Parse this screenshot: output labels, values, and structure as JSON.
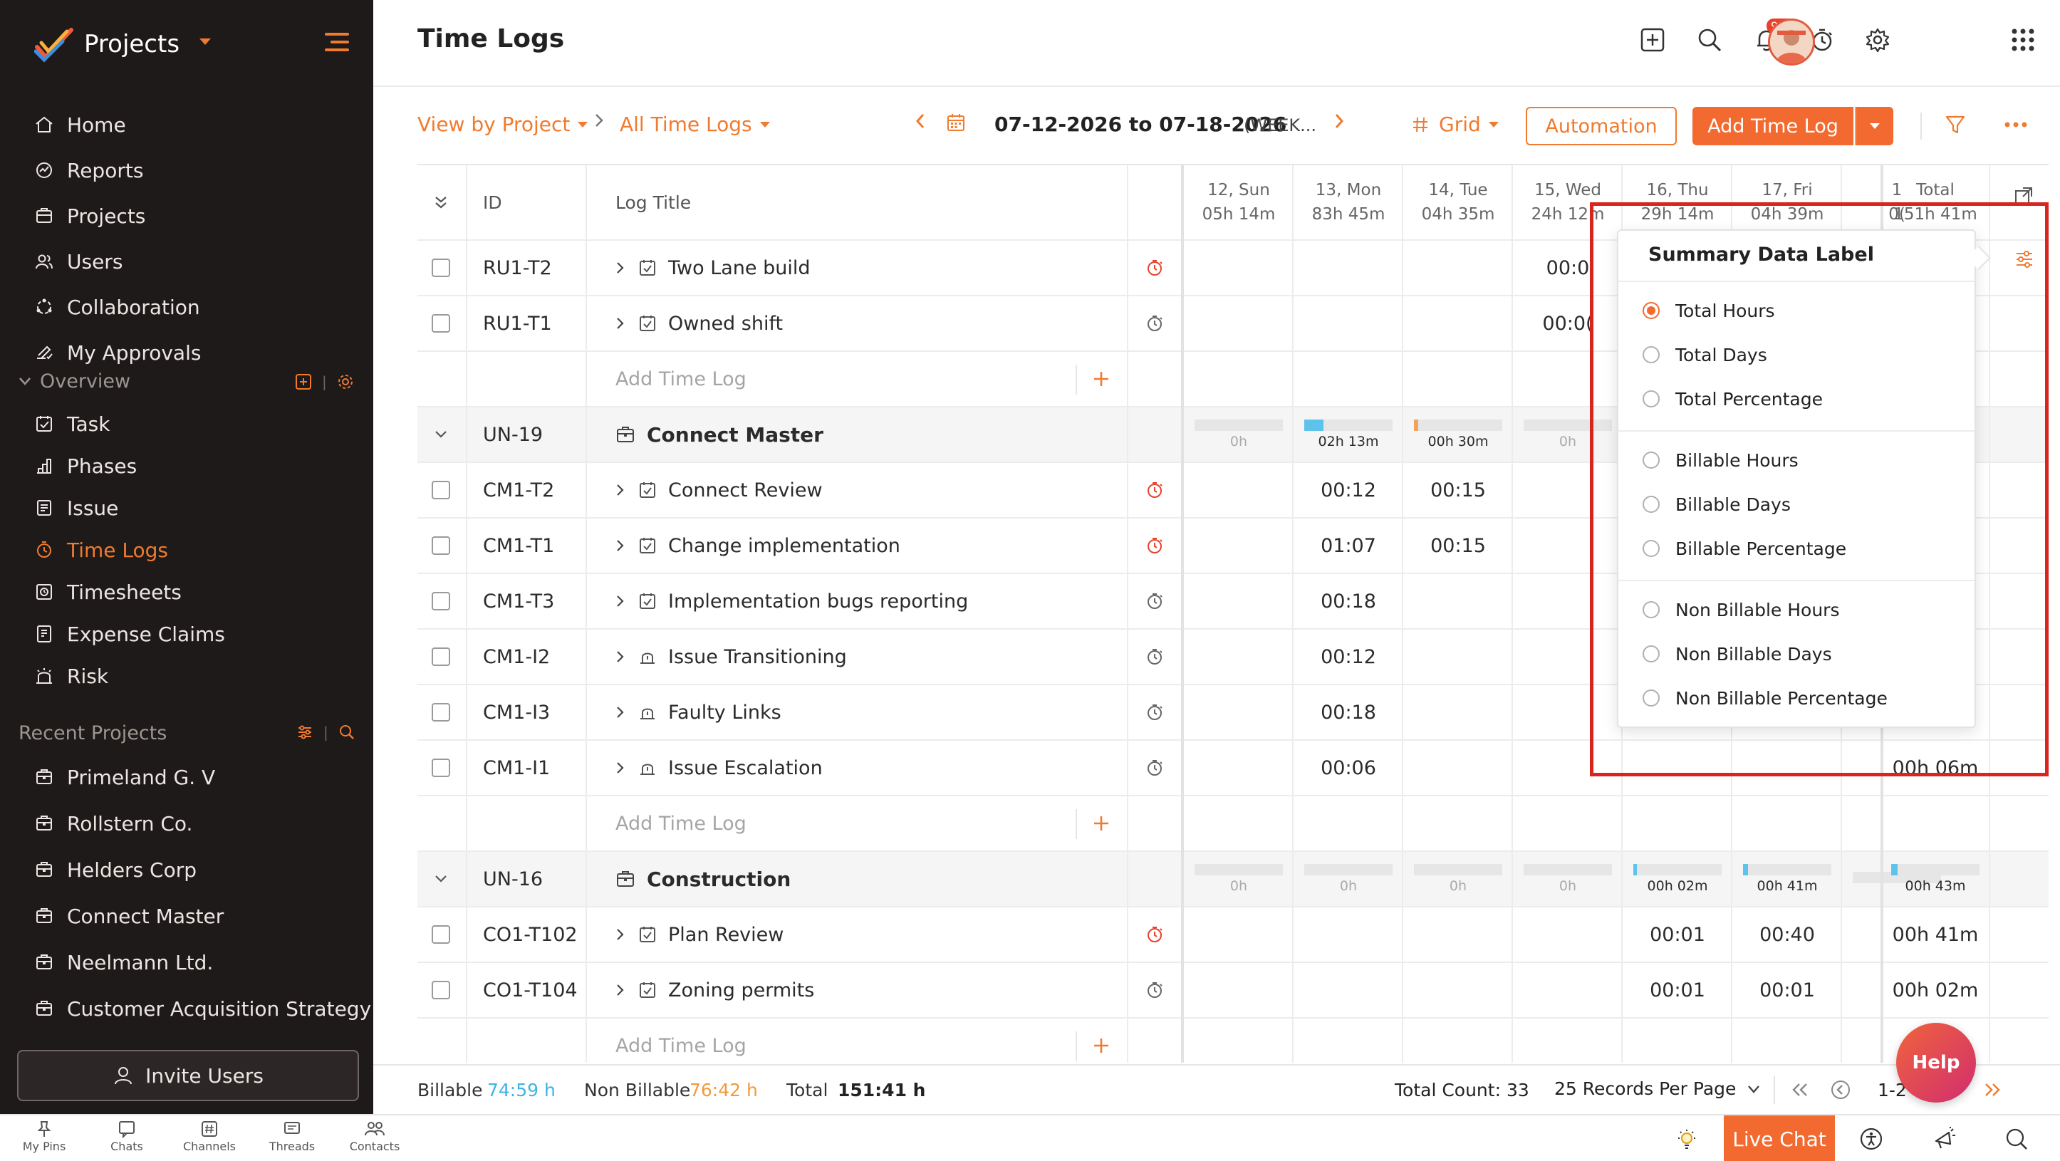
{
  "app": {
    "name": "Projects"
  },
  "sidebar": {
    "nav": [
      {
        "label": "Home",
        "icon": "home-icon"
      },
      {
        "label": "Reports",
        "icon": "reports-icon"
      },
      {
        "label": "Projects",
        "icon": "projects-icon"
      },
      {
        "label": "Users",
        "icon": "users-icon"
      },
      {
        "label": "Collaboration",
        "icon": "collaboration-icon"
      },
      {
        "label": "My Approvals",
        "icon": "approvals-icon"
      }
    ],
    "overview_label": "Overview",
    "overview_items": [
      {
        "label": "Task",
        "icon": "task-icon"
      },
      {
        "label": "Phases",
        "icon": "phases-icon"
      },
      {
        "label": "Issue",
        "icon": "issue-icon"
      },
      {
        "label": "Time Logs",
        "icon": "timer-icon",
        "active": true
      },
      {
        "label": "Timesheets",
        "icon": "timesheets-icon"
      },
      {
        "label": "Expense Claims",
        "icon": "expense-icon"
      },
      {
        "label": "Risk",
        "icon": "risk-icon"
      }
    ],
    "recent_label": "Recent Projects",
    "recent_projects": [
      "Primeland G. V",
      "Rollstern Co.",
      "Helders Corp",
      "Connect Master",
      "Neelmann Ltd.",
      "Customer Acquisition Strategy"
    ],
    "invite_label": "Invite Users"
  },
  "bottombar": {
    "items": [
      "My Pins",
      "Channels",
      "Threads",
      "Contacts",
      "Chats"
    ],
    "livechat": "Live Chat"
  },
  "header": {
    "title": "Time Logs",
    "notification_badge": "99+"
  },
  "toolbar": {
    "view_by": "View by Project",
    "filter": "All Time Logs",
    "date_range": "07-12-2026 to 07-18-2026",
    "range_type": "(WEEK...",
    "view_mode": "Grid",
    "automation": "Automation",
    "add_time_log": "Add Time Log"
  },
  "table": {
    "col_id": "ID",
    "col_title": "Log Title",
    "days": [
      {
        "day": "12, Sun",
        "total": "05h 14m"
      },
      {
        "day": "13, Mon",
        "total": "83h 45m"
      },
      {
        "day": "14, Tue",
        "total": "04h 35m"
      },
      {
        "day": "15, Wed",
        "total": "24h 12m"
      },
      {
        "day": "16, Thu",
        "total": "29h 14m"
      },
      {
        "day": "17, Fri",
        "total": "04h 39m"
      },
      {
        "day": "1",
        "total": "0("
      }
    ],
    "total_header": {
      "day": "Total",
      "total": "151h 41m"
    },
    "add_log_label": "Add Time Log",
    "rows": [
      {
        "type": "log",
        "id": "RU1-T2",
        "title": "Two Lane build",
        "kind": "task",
        "timer": "running",
        "values": [
          "",
          "",
          "",
          "00:0"
        ],
        "total": ""
      },
      {
        "type": "log",
        "id": "RU1-T1",
        "title": "Owned shift",
        "kind": "task",
        "timer": "idle",
        "values": [
          "",
          "",
          "",
          "00:0("
        ],
        "total": ""
      },
      {
        "type": "add"
      },
      {
        "type": "group",
        "id": "UN-19",
        "title": "Connect Master",
        "summary": [
          {
            "label": "0h",
            "fill": 0
          },
          {
            "label": "02h 13m",
            "fill": 0.22,
            "color": "#5ec3ea"
          },
          {
            "label": "00h 30m",
            "fill": 0.05,
            "color": "#f3a45a"
          },
          {
            "label": "0h",
            "fill": 0
          }
        ]
      },
      {
        "type": "log",
        "id": "CM1-T2",
        "title": "Connect Review",
        "kind": "task",
        "timer": "running",
        "values": [
          "",
          "00:12",
          "00:15",
          ""
        ],
        "total": ""
      },
      {
        "type": "log",
        "id": "CM1-T1",
        "title": "Change implementation",
        "kind": "task",
        "timer": "running",
        "values": [
          "",
          "01:07",
          "00:15",
          ""
        ],
        "total": ""
      },
      {
        "type": "log",
        "id": "CM1-T3",
        "title": "Implementation bugs reporting",
        "kind": "task",
        "timer": "idle",
        "values": [
          "",
          "00:18",
          "",
          ""
        ],
        "total": ""
      },
      {
        "type": "log",
        "id": "CM1-I2",
        "title": "Issue Transitioning",
        "kind": "issue",
        "timer": "idle",
        "values": [
          "",
          "00:12",
          "",
          ""
        ],
        "total": ""
      },
      {
        "type": "log",
        "id": "CM1-I3",
        "title": "Faulty Links",
        "kind": "issue",
        "timer": "idle",
        "values": [
          "",
          "00:18",
          "",
          ""
        ],
        "total": ""
      },
      {
        "type": "log",
        "id": "CM1-I1",
        "title": "Issue Escalation",
        "kind": "issue",
        "timer": "idle",
        "values": [
          "",
          "00:06",
          "",
          ""
        ],
        "total": "00h 06m"
      },
      {
        "type": "add"
      },
      {
        "type": "group",
        "id": "UN-16",
        "title": "Construction",
        "summary": [
          {
            "label": "0h",
            "fill": 0
          },
          {
            "label": "0h",
            "fill": 0
          },
          {
            "label": "0h",
            "fill": 0
          },
          {
            "label": "0h",
            "fill": 0
          },
          {
            "label": "00h 02m",
            "fill": 0.02,
            "color": "#5ec3ea"
          },
          {
            "label": "00h 41m",
            "fill": 0.06,
            "color": "#5ec3ea"
          },
          {
            "label": "",
            "fill": 0
          },
          {
            "label": "00h 43m",
            "fill": 0.07,
            "color": "#5ec3ea"
          }
        ]
      },
      {
        "type": "log",
        "id": "CO1-T102",
        "title": "Plan Review",
        "kind": "task",
        "timer": "running",
        "values": [
          "",
          "",
          "",
          "",
          "00:01",
          "00:40"
        ],
        "total": "00h 41m"
      },
      {
        "type": "log",
        "id": "CO1-T104",
        "title": "Zoning permits",
        "kind": "task",
        "timer": "idle",
        "values": [
          "",
          "",
          "",
          "",
          "00:01",
          "00:01"
        ],
        "total": "00h 02m"
      },
      {
        "type": "add"
      }
    ]
  },
  "footer": {
    "billable_label": "Billable",
    "billable_value": "74:59 h",
    "nonbillable_label": "Non Billable",
    "nonbillable_value": "76:42 h",
    "total_label": "Total",
    "total_value": "151:41 h",
    "total_count": "Total Count: 33",
    "per_page": "25 Records Per Page",
    "page_range": "1-2"
  },
  "popup": {
    "title": "Summary Data Label",
    "groups": [
      [
        {
          "label": "Total Hours",
          "selected": true
        },
        {
          "label": "Total Days"
        },
        {
          "label": "Total Percentage"
        }
      ],
      [
        {
          "label": "Billable Hours"
        },
        {
          "label": "Billable Days"
        },
        {
          "label": "Billable Percentage"
        }
      ],
      [
        {
          "label": "Non Billable Hours"
        },
        {
          "label": "Non Billable Days"
        },
        {
          "label": "Non Billable Percentage"
        }
      ]
    ]
  },
  "help_label": "Help",
  "colors": {
    "accent": "#f26a2f",
    "billable": "#3cb5e6",
    "nonbillable": "#f39a3c",
    "sidebar_bg": "#1f1a1a",
    "highlight": "#d8261e"
  }
}
